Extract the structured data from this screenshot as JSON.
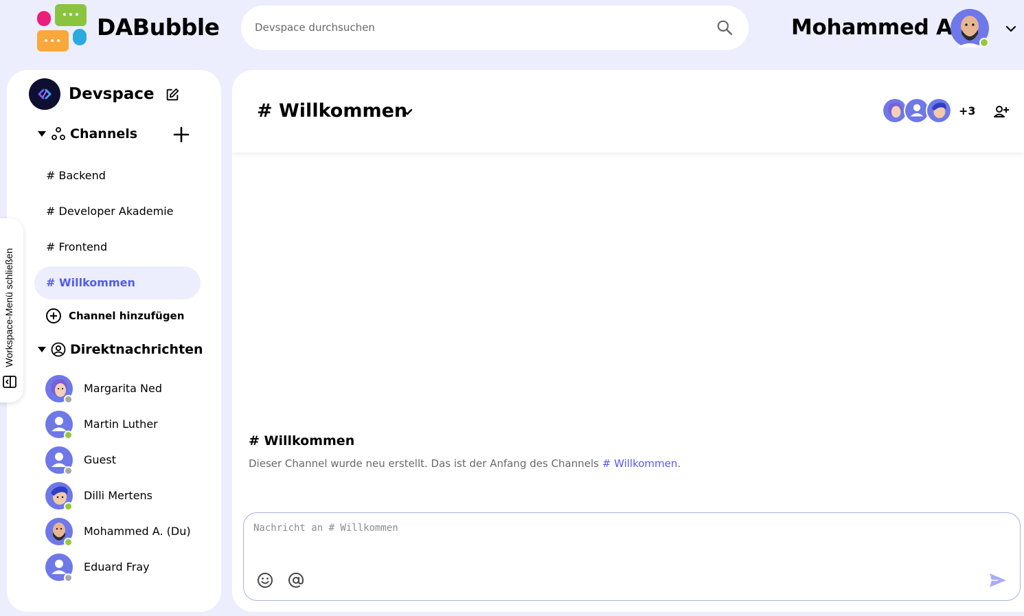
{
  "app": {
    "brand": "DABubble"
  },
  "search": {
    "placeholder": "Devspace durchsuchen"
  },
  "user": {
    "name": "Mohammed A."
  },
  "workspace": {
    "name": "Devspace"
  },
  "sidebar": {
    "channels_title": "Channels",
    "channels": [
      {
        "label": "# Backend"
      },
      {
        "label": "# Developer Akademie"
      },
      {
        "label": "# Frontend"
      },
      {
        "label": "# Willkommen",
        "active": true
      }
    ],
    "add_channel_label": "Channel hinzufügen",
    "dm_title": "Direktnachrichten",
    "dms": [
      {
        "name": "Margarita Ned",
        "status": "offline"
      },
      {
        "name": "Martin Luther",
        "status": "online"
      },
      {
        "name": "Guest",
        "status": "offline"
      },
      {
        "name": "Dilli Mertens",
        "status": "online"
      },
      {
        "name": "Mohammed A. (Du)",
        "status": "online"
      },
      {
        "name": "Eduard Fray",
        "status": "offline"
      }
    ],
    "toggle_label": "Workspace-Menü schließen"
  },
  "channel": {
    "title": "# Willkommen",
    "member_count": "+3",
    "intro_title": "# Willkommen",
    "intro_text": "Dieser Channel wurde neu erstellt. Das ist der Anfang des Channels ",
    "intro_link": "# Willkommen",
    "intro_end": "."
  },
  "composer": {
    "placeholder": "Nachricht an # Willkommen"
  },
  "colors": {
    "accent": "#535af1",
    "background": "#eceefe",
    "online": "#92c83e",
    "offline": "#a8a8a8"
  }
}
